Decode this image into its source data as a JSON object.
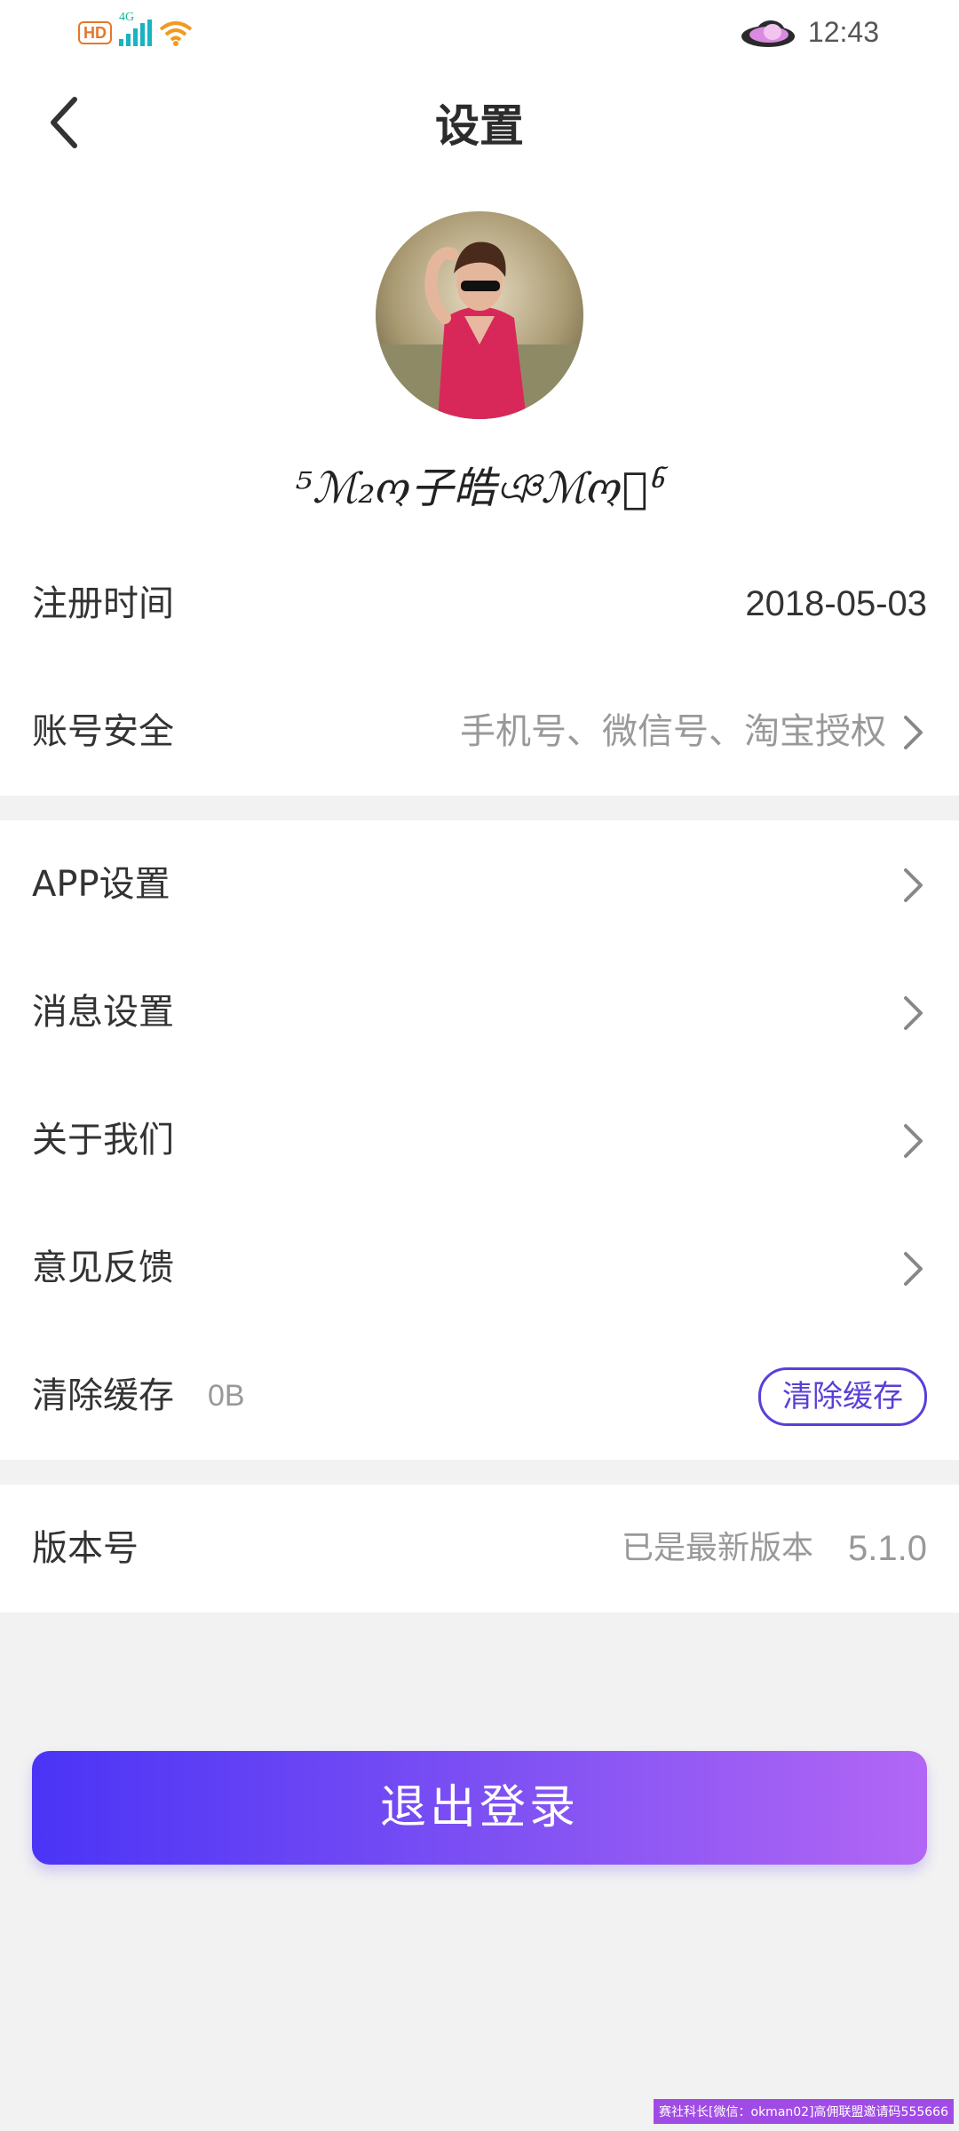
{
  "status_bar": {
    "hd_label": "HD",
    "network": "4G",
    "time": "12:43"
  },
  "header": {
    "title": "设置"
  },
  "profile": {
    "nickname": "⁵ℳ₂ო子皓ঞℳო⃒ჼ"
  },
  "rows": {
    "register": {
      "label": "注册时间",
      "value": "2018-05-03"
    },
    "account": {
      "label": "账号安全",
      "value": "手机号、微信号、淘宝授权"
    },
    "app": {
      "label": "APP设置"
    },
    "message": {
      "label": "消息设置"
    },
    "about": {
      "label": "关于我们"
    },
    "feedback": {
      "label": "意见反馈"
    },
    "cache": {
      "label": "清除缓存",
      "size": "0B",
      "button": "清除缓存"
    },
    "version": {
      "label": "版本号",
      "status": "已是最新版本",
      "number": "5.1.0"
    }
  },
  "logout_button": "退出登录",
  "watermark": "赛社科长[微信：okman02]高佣联盟邀请码555666",
  "colors": {
    "accent": "#5a3fd9",
    "gradient_start": "#4b34f6",
    "gradient_end": "#b266f5"
  }
}
